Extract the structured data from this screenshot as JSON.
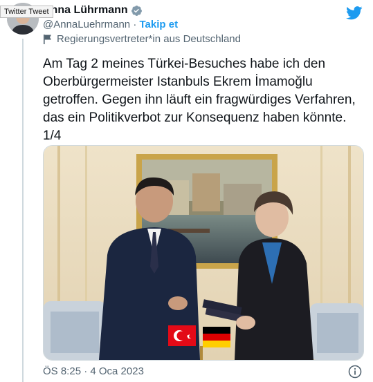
{
  "tooltip": "Twitter Tweet",
  "author": {
    "name": "Anna Lührmann",
    "handle": "@AnnaLuehrmann",
    "separator": "·",
    "follow_label": "Takip et",
    "label_text": "Regierungsvertreter*in aus Deutschland"
  },
  "tweet": {
    "text": "Am Tag 2 meines Türkei-Besuches habe ich den Oberbürgermeister Istanbuls Ekrem İmamoğlu getroffen. Gegen ihn läuft ein fragwürdiges Verfahren, das ein Politikverbot zur Konsequenz haben könnte. 1/4",
    "timestamp": "ÖS 8:25 · 4 Oca 2023"
  },
  "icons": {
    "verified": "verified-badge-icon",
    "flag": "flag-icon",
    "twitter": "twitter-bird-icon",
    "info": "info-icon"
  },
  "colors": {
    "twitter_blue": "#1d9bf0",
    "secondary_text": "#536471",
    "border": "#cfd9de"
  }
}
